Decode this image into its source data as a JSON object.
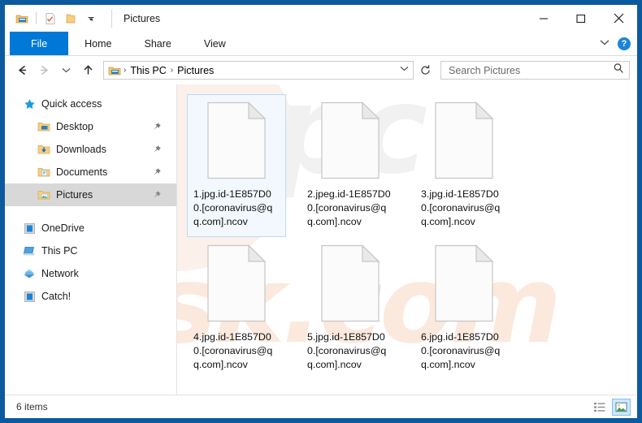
{
  "window": {
    "title": "Pictures",
    "quick_access_toolbar": [
      {
        "name": "explorer-icon",
        "tooltip": "Explorer"
      },
      {
        "name": "properties-icon",
        "tooltip": "Properties"
      },
      {
        "name": "new-folder-icon",
        "tooltip": "New folder"
      },
      {
        "name": "customize-chevron-icon",
        "tooltip": "Customize Quick Access Toolbar"
      }
    ],
    "controls": {
      "minimize": "minimize-button",
      "maximize": "maximize-button",
      "close": "close-button"
    }
  },
  "ribbon": {
    "tabs": [
      {
        "label": "File",
        "active": true
      },
      {
        "label": "Home",
        "active": false
      },
      {
        "label": "Share",
        "active": false
      },
      {
        "label": "View",
        "active": false
      }
    ],
    "expand_icon": "chevron-down-icon",
    "help_label": "?"
  },
  "address": {
    "back": "back-arrow-icon",
    "forward": "forward-arrow-icon",
    "recent": "chevron-down-icon",
    "up": "up-arrow-icon",
    "breadcrumb_icon": "folder-icon",
    "breadcrumbs": [
      "This PC",
      "Pictures"
    ],
    "separator": "›",
    "dropdown_icon": "chevron-down-icon",
    "refresh_icon": "refresh-icon"
  },
  "search": {
    "placeholder": "Search Pictures",
    "icon": "search-icon"
  },
  "sidebar": {
    "groups": [
      {
        "header": {
          "label": "Quick access",
          "icon": "star-icon"
        },
        "items": [
          {
            "label": "Desktop",
            "icon": "folder-desktop-icon",
            "pinned": true,
            "selected": false
          },
          {
            "label": "Downloads",
            "icon": "folder-downloads-icon",
            "pinned": true,
            "selected": false
          },
          {
            "label": "Documents",
            "icon": "folder-documents-icon",
            "pinned": true,
            "selected": false
          },
          {
            "label": "Pictures",
            "icon": "folder-pictures-icon",
            "pinned": true,
            "selected": true
          }
        ]
      },
      {
        "header": null,
        "items": [
          {
            "label": "OneDrive",
            "icon": "onedrive-icon",
            "pinned": false,
            "selected": false
          },
          {
            "label": "This PC",
            "icon": "this-pc-icon",
            "pinned": false,
            "selected": false
          },
          {
            "label": "Network",
            "icon": "network-icon",
            "pinned": false,
            "selected": false
          },
          {
            "label": "Catch!",
            "icon": "catch-drive-icon",
            "pinned": false,
            "selected": false
          }
        ]
      }
    ]
  },
  "files": [
    {
      "name": "1.jpg.id-1E857D00.[coronavirus@qq.com].ncov",
      "icon": "generic-file-icon",
      "selected": true
    },
    {
      "name": "2.jpeg.id-1E857D00.[coronavirus@qq.com].ncov",
      "icon": "generic-file-icon",
      "selected": false
    },
    {
      "name": "3.jpg.id-1E857D00.[coronavirus@qq.com].ncov",
      "icon": "generic-file-icon",
      "selected": false
    },
    {
      "name": "4.jpg.id-1E857D00.[coronavirus@qq.com].ncov",
      "icon": "generic-file-icon",
      "selected": false
    },
    {
      "name": "5.jpg.id-1E857D00.[coronavirus@qq.com].ncov",
      "icon": "generic-file-icon",
      "selected": false
    },
    {
      "name": "6.jpg.id-1E857D00.[coronavirus@qq.com].ncov",
      "icon": "generic-file-icon",
      "selected": false
    }
  ],
  "status": {
    "item_count": "6 items",
    "views": [
      {
        "name": "details-view-button",
        "active": false
      },
      {
        "name": "large-icons-view-button",
        "active": true
      }
    ]
  },
  "watermark": {
    "top_text": "pc",
    "bottom_text": "risk.com"
  },
  "colors": {
    "accent": "#0078d7",
    "frame": "#0b5a9e",
    "selection_fill": "#f2f8fd",
    "selection_border": "#bcdcf4",
    "nav_selected": "#d8d8d8",
    "watermark_orange": "#fbe9dd"
  }
}
